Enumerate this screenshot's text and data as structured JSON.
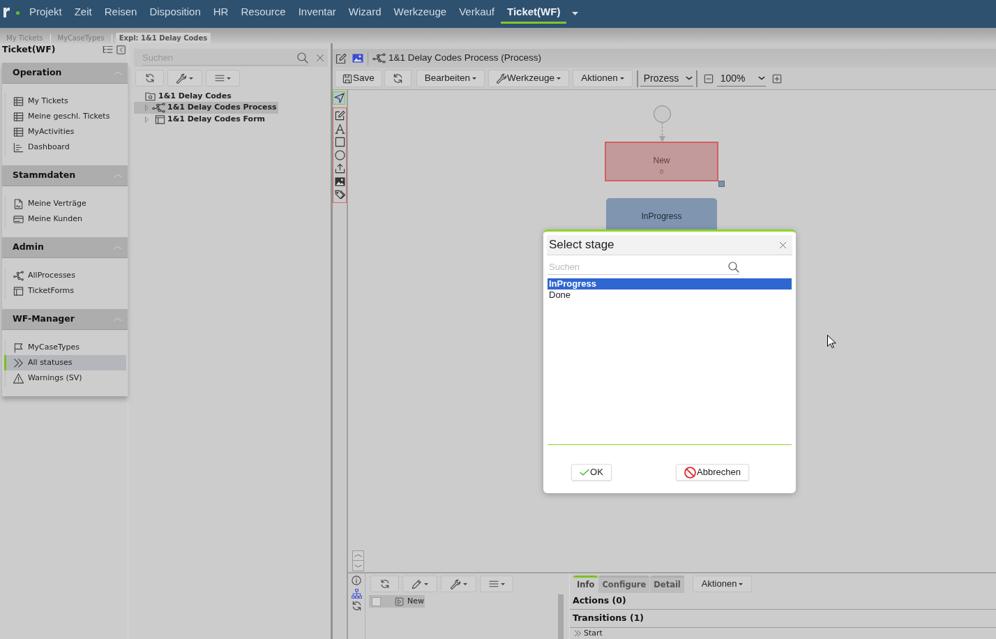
{
  "top_nav": {
    "items": [
      {
        "label": "Projekt",
        "selected": false
      },
      {
        "label": "Zeit",
        "selected": false
      },
      {
        "label": "Reisen",
        "selected": false
      },
      {
        "label": "Disposition",
        "selected": false
      },
      {
        "label": "HR",
        "selected": false
      },
      {
        "label": "Resource",
        "selected": false
      },
      {
        "label": "Inventar",
        "selected": false
      },
      {
        "label": "Wizard",
        "selected": false
      },
      {
        "label": "Werkzeuge",
        "selected": false
      },
      {
        "label": "Verkauf",
        "selected": false
      },
      {
        "label": "Ticket(WF)",
        "selected": true
      }
    ]
  },
  "breadcrumbs": [
    {
      "label": "My Tickets",
      "selected": false
    },
    {
      "label": "MyCaseTypes",
      "selected": false
    },
    {
      "label": "Expl: 1&1 Delay Codes",
      "selected": true
    }
  ],
  "sidebar": {
    "title": "Ticket(WF)",
    "sections": [
      {
        "title": "Operation",
        "expanded": true,
        "items": [
          {
            "label": "My Tickets",
            "selected": false
          },
          {
            "label": "Meine geschl. Tickets",
            "selected": false
          },
          {
            "label": "MyActivities",
            "selected": false
          },
          {
            "label": "Dashboard",
            "selected": false
          }
        ]
      },
      {
        "title": "Stammdaten",
        "expanded": true,
        "items": [
          {
            "label": "Meine Verträge",
            "selected": false
          },
          {
            "label": "Meine Kunden",
            "selected": false
          }
        ]
      },
      {
        "title": "Admin",
        "expanded": true,
        "items": [
          {
            "label": "AllProcesses",
            "selected": false
          },
          {
            "label": "TicketForms",
            "selected": false
          }
        ]
      },
      {
        "title": "WF-Manager",
        "expanded": true,
        "items": [
          {
            "label": "MyCaseTypes",
            "selected": false
          },
          {
            "label": "All statuses",
            "selected": true
          },
          {
            "label": "Warnings (SV)",
            "selected": false
          }
        ]
      }
    ]
  },
  "explorer": {
    "search": {
      "placeholder": "Suchen"
    },
    "tree": [
      {
        "label": "1&1 Delay Codes",
        "selected": false,
        "children": [
          {
            "label": "1&1 Delay Codes Process",
            "selected": true,
            "expanded": false
          },
          {
            "label": "1&1 Delay Codes Form",
            "selected": false,
            "expanded": false
          }
        ]
      }
    ]
  },
  "editor": {
    "title": "1&1 Delay Codes Process (Process)",
    "toolbar": {
      "save": "Save",
      "menus": [
        "Bearbeiten",
        "Werkzeuge",
        "Aktionen"
      ],
      "view": "Prozess",
      "zoom": "100%"
    },
    "tools": [
      {
        "selected": true
      },
      {
        "selected": false
      },
      {
        "selected": false
      },
      {
        "selected": false
      },
      {
        "selected": false
      },
      {
        "selected": false
      },
      {
        "selected": false
      },
      {
        "selected": false
      }
    ],
    "diagram": {
      "nodes": [
        {
          "kind": "start"
        },
        {
          "kind": "stage",
          "label": "New",
          "count": "0",
          "selected": true
        },
        {
          "kind": "stage",
          "label": "InProgress",
          "selected": false
        }
      ]
    }
  },
  "bottom_list": {
    "rows": [
      {
        "label": "New",
        "checked": false,
        "selected": true
      }
    ]
  },
  "details": {
    "tabs": [
      {
        "label": "Info",
        "selected": true
      },
      {
        "label": "Configure",
        "selected": false
      },
      {
        "label": "Detail",
        "selected": false
      }
    ],
    "menu": "Aktionen",
    "sections": [
      {
        "title": "Actions (0)"
      },
      {
        "title": "Transitions (1)",
        "items": [
          "Start"
        ]
      }
    ]
  },
  "dialog": {
    "title": "Select stage",
    "search": {
      "placeholder": "Suchen"
    },
    "options": [
      {
        "label": "InProgress",
        "selected": true
      },
      {
        "label": "Done",
        "selected": false
      }
    ],
    "buttons": [
      {
        "kind": "ok",
        "label": "OK"
      },
      {
        "kind": "cancel",
        "label": "Abbrechen"
      }
    ]
  }
}
